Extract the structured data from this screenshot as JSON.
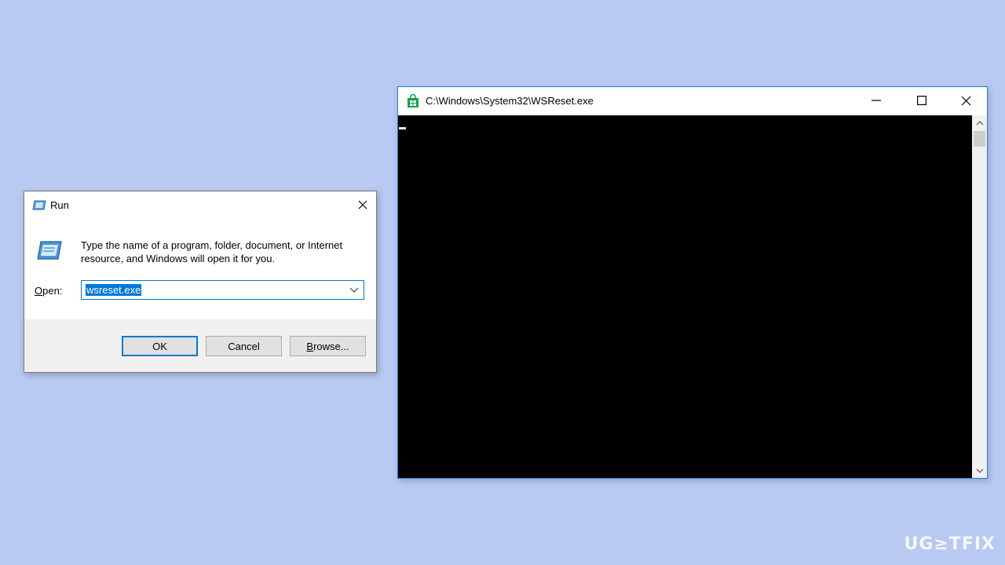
{
  "run_dialog": {
    "title": "Run",
    "description": "Type the name of a program, folder, document, or Internet resource, and Windows will open it for you.",
    "open_label_prefix": "O",
    "open_label_rest": "pen:",
    "open_value": "wsreset.exe",
    "buttons": {
      "ok": "OK",
      "cancel": "Cancel",
      "browse": "Browse..."
    },
    "icons": {
      "title": "run-icon",
      "close": "close-icon",
      "dropdown": "chevron-down-icon"
    }
  },
  "console_window": {
    "title": "C:\\Windows\\System32\\WSReset.exe",
    "icons": {
      "app": "store-bag-icon",
      "minimize": "minimize-icon",
      "maximize": "maximize-icon",
      "close": "close-icon"
    },
    "colors": {
      "body": "#000000",
      "icon": "#16a04b"
    }
  },
  "watermark": {
    "text": "UG≥TFIX"
  },
  "colors": {
    "desktop": "#b8c9f2",
    "accent": "#0078d7"
  }
}
